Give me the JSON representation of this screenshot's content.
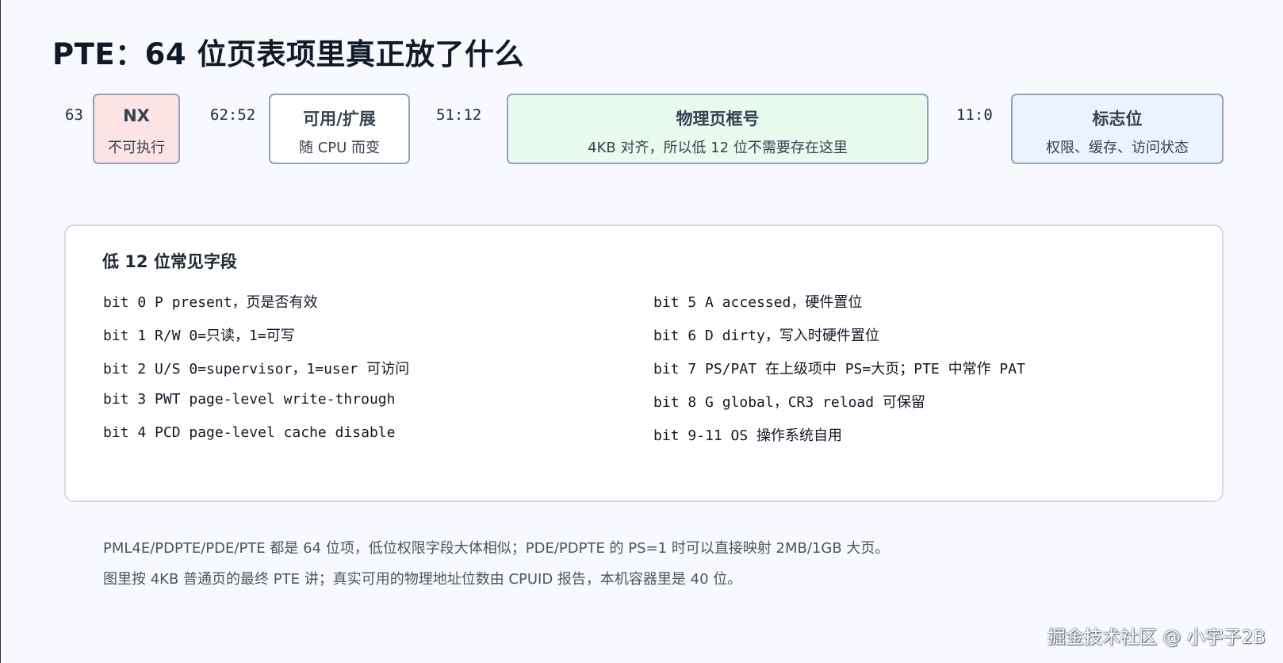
{
  "title": "PTE：64 位页表项里真正放了什么",
  "layout_fields": [
    {
      "range": "63",
      "name": "NX",
      "desc": "不可执行",
      "fill": "#fde4e4"
    },
    {
      "range": "62:52",
      "name": "可用/扩展",
      "desc": "随 CPU 而变",
      "fill": "#ffffff"
    },
    {
      "range": "51:12",
      "name": "物理页框号",
      "desc": "4KB 对齐，所以低 12 位不需要存在这里",
      "fill": "#e8fbee"
    },
    {
      "range": "11:0",
      "name": "标志位",
      "desc": "权限、缓存、访问状态",
      "fill": "#eaf3ff"
    }
  ],
  "low_bits": {
    "heading": "低 12 位常见字段",
    "left_rows": [
      "bit 0 P present，页是否有效",
      "bit 1 R/W 0=只读，1=可写",
      "bit 2 U/S 0=supervisor，1=user 可访问",
      "bit 3 PWT page-level write-through",
      "bit 4 PCD page-level cache disable"
    ],
    "right_rows": [
      "bit 5 A accessed，硬件置位",
      "bit 6 D dirty，写入时硬件置位",
      "bit 7 PS/PAT 在上级项中 PS=大页；PTE 中常作 PAT",
      "bit 8 G global，CR3 reload 可保留",
      "bit 9-11 OS 操作系统自用"
    ]
  },
  "notes": [
    "PML4E/PDPTE/PDE/PTE 都是 64 位项，低位权限字段大体相似；PDE/PDPTE 的 PS=1 时可以直接映射 2MB/1GB 大页。",
    "图里按 4KB 普通页的最终 PTE 讲；真实可用的物理地址位数由 CPUID 报告，本机容器里是 40 位。"
  ],
  "watermark": "掘金技术社区 @ 小宇子2B"
}
